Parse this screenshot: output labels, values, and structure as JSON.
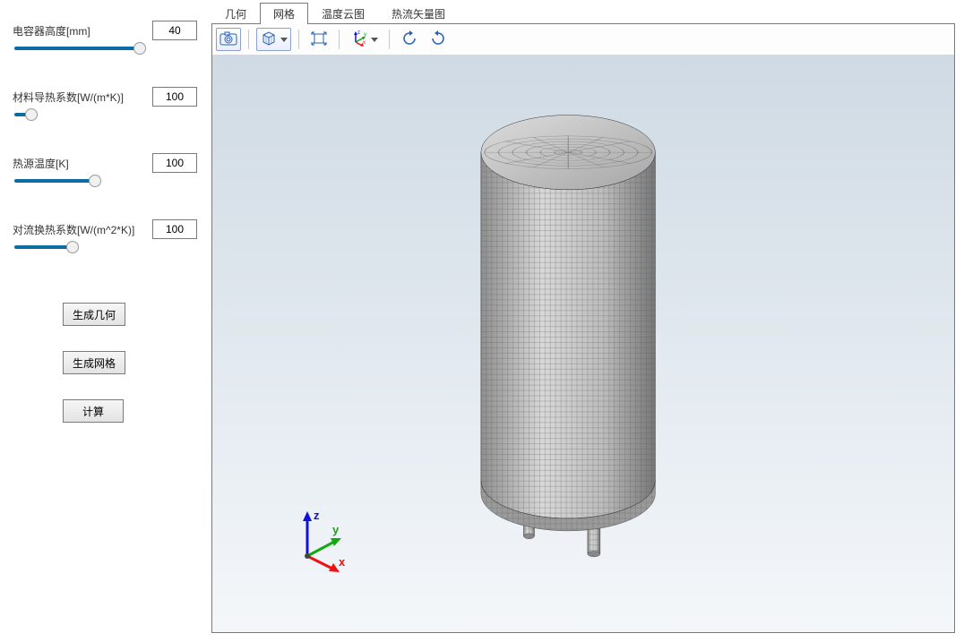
{
  "params": [
    {
      "label": "电容器高度[mm]",
      "value": "40",
      "fill_pct": 88,
      "thumb_pct": 90
    },
    {
      "label": "材料导热系数[W/(m*K)]",
      "value": "100",
      "fill_pct": 10,
      "thumb_pct": 12
    },
    {
      "label": "热源温度[K]",
      "value": "100",
      "fill_pct": 56,
      "thumb_pct": 58
    },
    {
      "label": "对流换热系数[W/(m^2*K)]",
      "value": "100",
      "fill_pct": 40,
      "thumb_pct": 42
    }
  ],
  "buttons": {
    "gen_geometry": "生成几何",
    "gen_mesh": "生成网格",
    "compute": "计算"
  },
  "tabs": [
    {
      "id": "geometry",
      "label": "几何",
      "active": false
    },
    {
      "id": "mesh",
      "label": "网格",
      "active": true
    },
    {
      "id": "temp",
      "label": "温度云图",
      "active": false
    },
    {
      "id": "heatflux",
      "label": "热流矢量图",
      "active": false
    }
  ],
  "triad": {
    "x": "x",
    "y": "y",
    "z": "z"
  },
  "toolbar_icons": {
    "camera": "camera-icon",
    "cube": "cube-view-icon",
    "fit": "zoom-extents-icon",
    "axes": "axis-xyz-icon",
    "rotate_ccw": "rotate-ccw-icon",
    "rotate_cw": "rotate-cw-icon"
  },
  "colors": {
    "slider_fill": "#0d6ca3",
    "triad_x": "#e11",
    "triad_y": "#1a1",
    "triad_z": "#11d",
    "toolbar_blue": "#2a5fb8"
  }
}
